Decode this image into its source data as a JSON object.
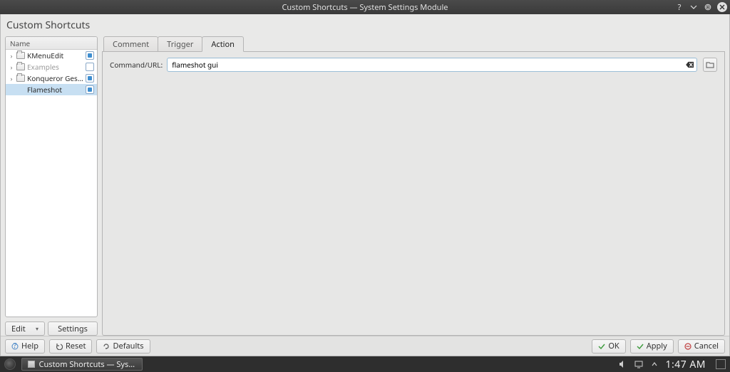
{
  "titlebar": {
    "title": "Custom Shortcuts — System Settings Module"
  },
  "module_title": "Custom Shortcuts",
  "tree": {
    "header": "Name",
    "items": [
      {
        "label": "KMenuEdit",
        "folder": true,
        "expand": true,
        "checked": true,
        "selected": false,
        "disabled": false
      },
      {
        "label": "Examples",
        "folder": true,
        "expand": true,
        "checked": false,
        "selected": false,
        "disabled": true
      },
      {
        "label": "Konqueror Gestures",
        "folder": true,
        "expand": true,
        "checked": true,
        "selected": false,
        "disabled": false
      },
      {
        "label": "Flameshot",
        "folder": false,
        "expand": false,
        "checked": true,
        "selected": true,
        "disabled": false
      }
    ]
  },
  "left_buttons": {
    "edit": "Edit",
    "settings": "Settings"
  },
  "tabs": {
    "comment": "Comment",
    "trigger": "Trigger",
    "action": "Action",
    "active": "action"
  },
  "action_form": {
    "label": "Command/URL:",
    "value": "flameshot gui"
  },
  "footer": {
    "help": "Help",
    "reset": "Reset",
    "defaults": "Defaults",
    "ok": "OK",
    "apply": "Apply",
    "cancel": "Cancel"
  },
  "taskbar": {
    "task": "Custom Shortcuts — System Setti...",
    "clock": "1:47 AM"
  }
}
